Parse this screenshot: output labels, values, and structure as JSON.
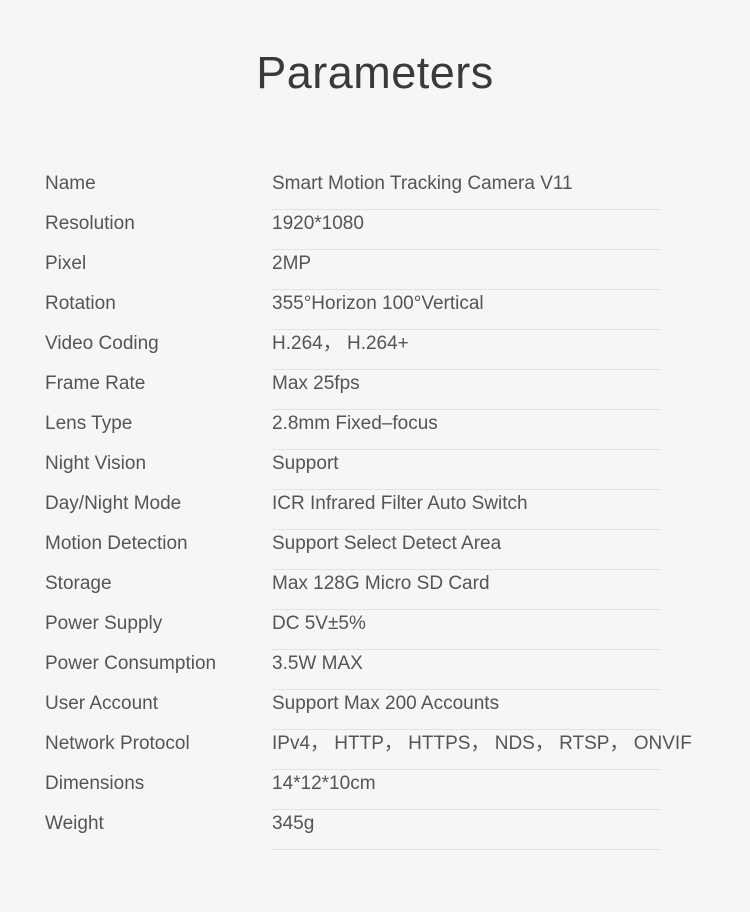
{
  "page": {
    "title": "Parameters",
    "background_color": "#f6f6f6",
    "text_color": "#555555",
    "rule_color": "#e2e2e2"
  },
  "spec_table": {
    "rows": [
      {
        "label": "Name",
        "value": "Smart Motion Tracking Camera V11"
      },
      {
        "label": "Resolution",
        "value": "1920*1080"
      },
      {
        "label": "Pixel",
        "value": "2MP"
      },
      {
        "label": "Rotation",
        "value": "355°Horizon   100°Vertical"
      },
      {
        "label": "Video Coding",
        "value": "H.264， H.264+"
      },
      {
        "label": "Frame Rate",
        "value": "Max 25fps"
      },
      {
        "label": "Lens Type",
        "value": "2.8mm Fixed–focus"
      },
      {
        "label": "Night Vision",
        "value": "Support"
      },
      {
        "label": "Day/Night Mode",
        "value": "ICR Infrared Filter Auto Switch"
      },
      {
        "label": "Motion Detection",
        "value": "Support Select Detect Area"
      },
      {
        "label": "Storage",
        "value": "Max 128G Micro SD Card"
      },
      {
        "label": "Power Supply",
        "value": "DC 5V±5%"
      },
      {
        "label": "Power Consumption",
        "value": "3.5W MAX"
      },
      {
        "label": "User Account",
        "value": "Support Max 200 Accounts"
      },
      {
        "label": "Network Protocol",
        "value": "IPv4， HTTP， HTTPS， NDS， RTSP， ONVIF"
      },
      {
        "label": "Dimensions",
        "value": "14*12*10cm"
      },
      {
        "label": "Weight",
        "value": "345g"
      }
    ]
  }
}
